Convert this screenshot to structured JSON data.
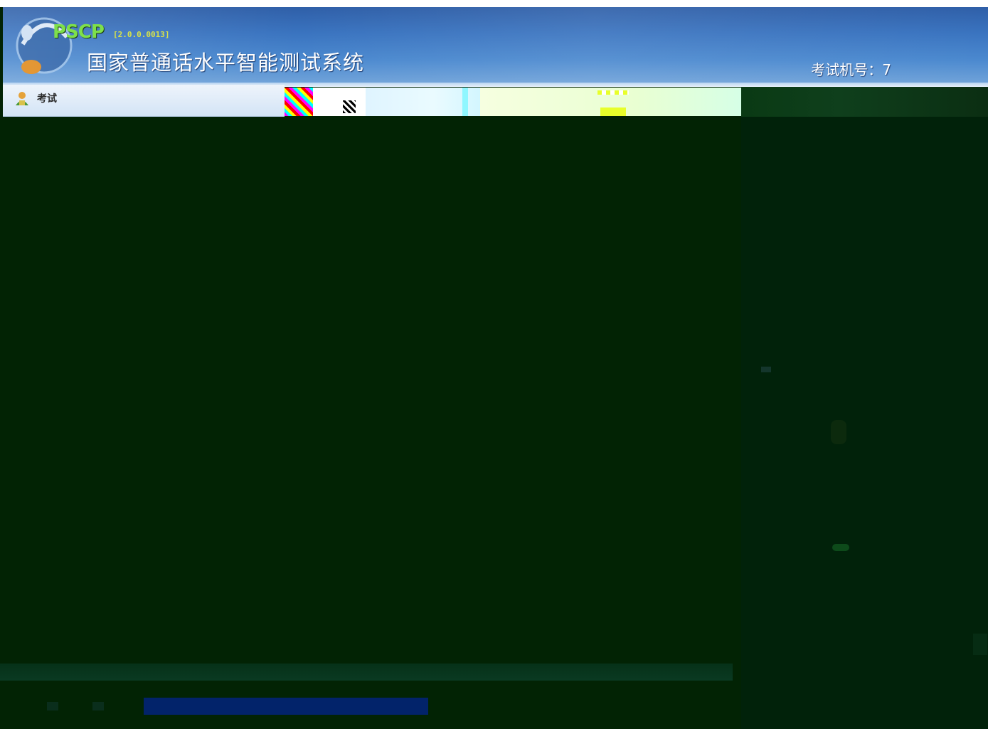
{
  "header": {
    "brand": "PSCP",
    "version": "[2.0.0.0013]",
    "title": "国家普通话水平智能测试系统",
    "machine_label": "考试机号：7"
  },
  "menu": {
    "items": [
      {
        "label": "考试",
        "icon": "examiner-person-icon"
      }
    ]
  },
  "colors": {
    "header_blue": "#3a74c0",
    "background_dark_green": "#022304",
    "brand_green": "#7ee04a",
    "progress_blue": "#02236a"
  }
}
